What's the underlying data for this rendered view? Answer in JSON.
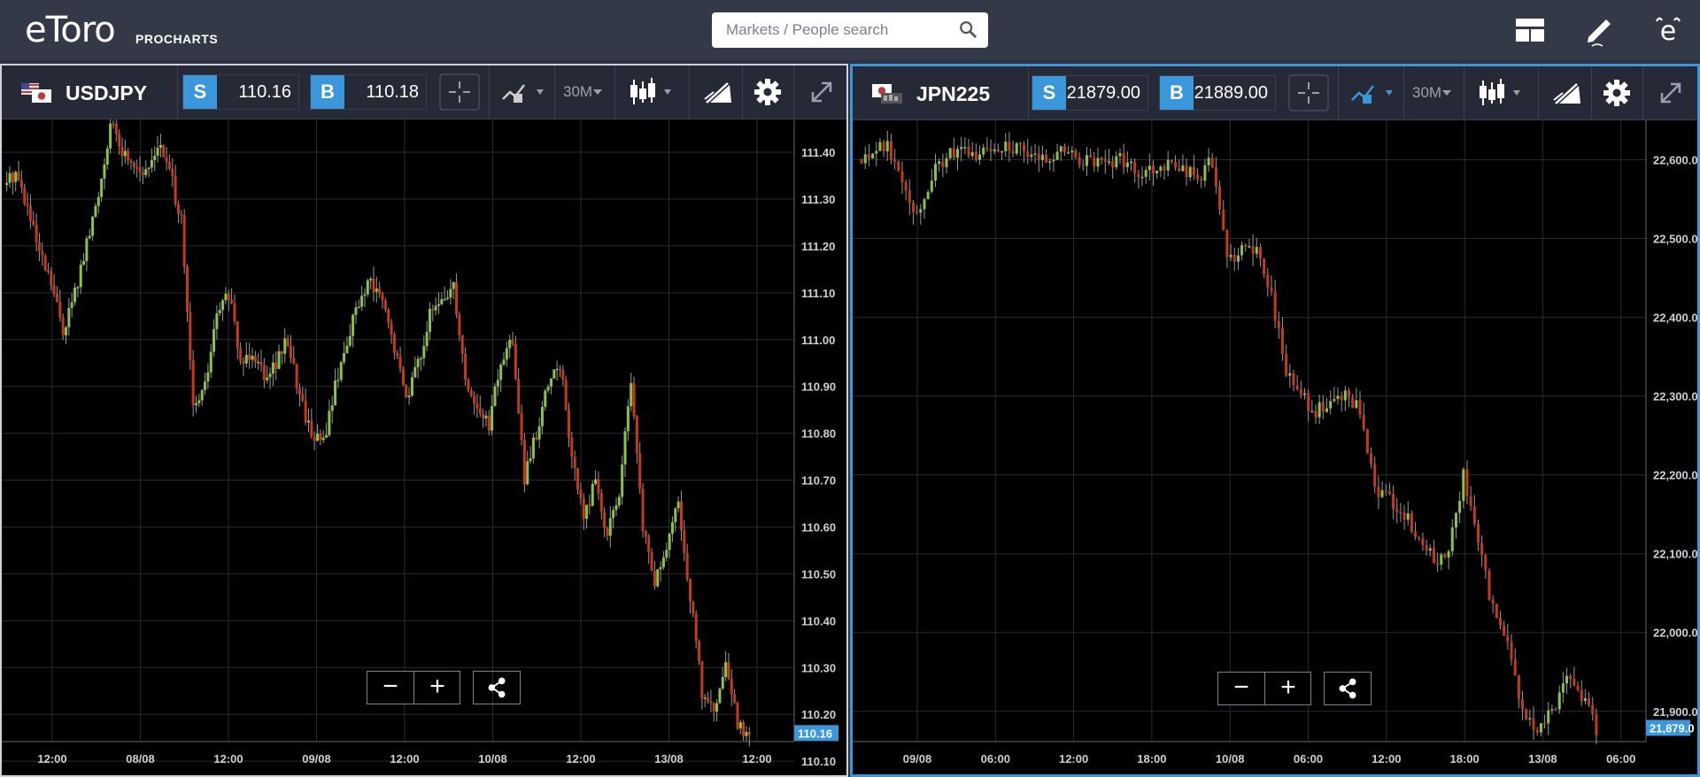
{
  "app": {
    "logo": "eToro",
    "logo_sub": "PROCHARTS"
  },
  "search": {
    "placeholder": "Markets / People search"
  },
  "icons": {
    "search": "search-icon",
    "layout": "layout-icon",
    "edit": "pencil-icon",
    "user": "etoro-user-icon"
  },
  "colors": {
    "accent": "#3a97dc",
    "bull": "#8bc24a",
    "bear": "#c5391c",
    "topbar": "#343948",
    "toolbar": "#262a36"
  },
  "panels": [
    {
      "symbol": "USDJPY",
      "sell_label": "S",
      "sell": "110.16",
      "buy_label": "B",
      "buy": "110.18",
      "timeframe": "30M",
      "price_tag": "110.16",
      "y_labels": [
        "111.40",
        "111.30",
        "111.20",
        "111.10",
        "111.00",
        "110.90",
        "110.80",
        "110.70",
        "110.60",
        "110.50",
        "110.40",
        "110.30",
        "110.20",
        "110.10"
      ],
      "x_labels": [
        "12:00",
        "08/08",
        "12:00",
        "09/08",
        "12:00",
        "10/08",
        "12:00",
        "13/08",
        "12:00"
      ]
    },
    {
      "symbol": "JPN225",
      "sell_label": "S",
      "sell": "21879.00",
      "buy_label": "B",
      "buy": "21889.00",
      "timeframe": "30M",
      "price_tag": "21,879.0",
      "y_labels": [
        "22,600.0",
        "22,500.0",
        "22,400.0",
        "22,300.0",
        "22,200.0",
        "22,100.0",
        "22,000.0",
        "21,900.0"
      ],
      "x_labels": [
        "09/08",
        "06:00",
        "12:00",
        "18:00",
        "10/08",
        "06:00",
        "12:00",
        "18:00",
        "13/08",
        "06:00"
      ]
    }
  ],
  "chart_data": [
    {
      "type": "candlestick",
      "title": "USDJPY",
      "timeframe": "30M",
      "ylim": [
        110.07,
        111.47
      ],
      "x_ticks": [
        "12:00",
        "08/08",
        "12:00",
        "09/08",
        "12:00",
        "10/08",
        "12:00",
        "13/08",
        "12:00"
      ],
      "y_ticks": [
        111.4,
        111.3,
        111.2,
        111.1,
        111.0,
        110.9,
        110.8,
        110.7,
        110.6,
        110.5,
        110.4,
        110.3,
        110.2,
        110.1
      ],
      "last_price": 110.16,
      "path": [
        111.33,
        111.36,
        111.28,
        111.18,
        111.12,
        111.02,
        111.1,
        111.2,
        111.31,
        111.46,
        111.4,
        111.38,
        111.35,
        111.42,
        111.36,
        111.25,
        110.85,
        110.9,
        111.05,
        111.1,
        110.95,
        110.98,
        110.93,
        110.95,
        111.0,
        110.88,
        110.8,
        110.78,
        110.9,
        111.0,
        111.08,
        111.12,
        111.08,
        110.98,
        110.88,
        110.95,
        111.05,
        111.08,
        111.12,
        110.92,
        110.85,
        110.82,
        110.95,
        111.0,
        110.7,
        110.8,
        110.9,
        110.95,
        110.75,
        110.62,
        110.7,
        110.58,
        110.68,
        110.9,
        110.6,
        110.48,
        110.55,
        110.65,
        110.45,
        110.25,
        110.2,
        110.3,
        110.18,
        110.16
      ]
    },
    {
      "type": "candlestick",
      "title": "JPN225",
      "timeframe": "30M",
      "ylim": [
        21820,
        22650
      ],
      "x_ticks": [
        "09/08",
        "06:00",
        "12:00",
        "18:00",
        "10/08",
        "06:00",
        "12:00",
        "18:00",
        "13/08",
        "06:00"
      ],
      "y_ticks": [
        22600,
        22500,
        22400,
        22300,
        22200,
        22100,
        22000,
        21900
      ],
      "last_price": 21879.0,
      "path": [
        22600,
        22615,
        22618,
        22580,
        22530,
        22580,
        22605,
        22610,
        22605,
        22615,
        22620,
        22610,
        22600,
        22605,
        22612,
        22600,
        22595,
        22600,
        22598,
        22585,
        22590,
        22595,
        22590,
        22575,
        22600,
        22470,
        22490,
        22480,
        22430,
        22330,
        22300,
        22280,
        22290,
        22300,
        22280,
        22180,
        22170,
        22150,
        22120,
        22090,
        22100,
        22200,
        22110,
        22030,
        21980,
        21900,
        21870,
        21900,
        21950,
        21920,
        21879
      ]
    }
  ]
}
